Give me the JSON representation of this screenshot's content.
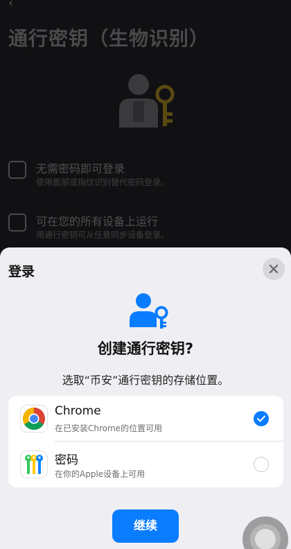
{
  "background": {
    "title": "通行密钥（生物识别）",
    "features": [
      {
        "title": "无需密码即可登录",
        "subtitle": "使用面部或指纹识别替代密码登录。"
      },
      {
        "title": "可在您的所有设备上运行",
        "subtitle": "用通行密钥可从任意同步设备登录。"
      }
    ]
  },
  "sheet": {
    "title": "登录",
    "heading": "创建通行密钥?",
    "description": "选取“币安”通行密钥的存储位置。",
    "options": [
      {
        "name": "Chrome",
        "subtitle": "在已安装Chrome的位置可用",
        "selected": true,
        "icon": "chrome-icon"
      },
      {
        "name": "密码",
        "subtitle": "在你的Apple设备上可用",
        "selected": false,
        "icon": "passwords-app-icon"
      }
    ],
    "continue_label": "继续"
  },
  "colors": {
    "accent": "#0a7cff",
    "sheet_bg": "#efeff3"
  }
}
